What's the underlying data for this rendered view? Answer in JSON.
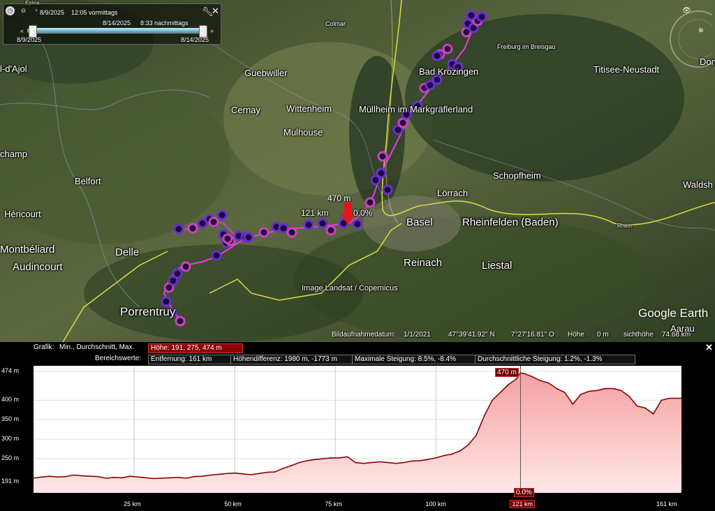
{
  "time_slider": {
    "start_datetime": "8/9/2025",
    "start_time": "12:05 vormittags",
    "current_datetime": "8/14/2025",
    "current_time": "8:33 nachmittags",
    "range_start": "8/9/2025",
    "range_end": "8/14/2025"
  },
  "map": {
    "places": [
      {
        "name": "Colmar",
        "size": "small"
      },
      {
        "name": "Freiburg im Breisgau",
        "size": "small"
      },
      {
        "name": "Bad Krozingen",
        "size": "normal"
      },
      {
        "name": "Titisee-Neustadt",
        "size": "normal"
      },
      {
        "name": "Guebwiller",
        "size": "normal"
      },
      {
        "name": "Cernay",
        "size": "normal"
      },
      {
        "name": "Wittenheim",
        "size": "normal"
      },
      {
        "name": "Müllheim im Markgräflerland",
        "size": "normal"
      },
      {
        "name": "Mulhouse",
        "size": "normal"
      },
      {
        "name": "Schopfheim",
        "size": "normal"
      },
      {
        "name": "Belfort",
        "size": "normal"
      },
      {
        "name": "Héricourt",
        "size": "normal"
      },
      {
        "name": "Lörrach",
        "size": "normal"
      },
      {
        "name": "Basel",
        "size": "big"
      },
      {
        "name": "Rheinfelden (Baden)",
        "size": "big"
      },
      {
        "name": "Montbéliard",
        "size": "big"
      },
      {
        "name": "Delle",
        "size": "big"
      },
      {
        "name": "Audincourt",
        "size": "big"
      },
      {
        "name": "Reinach",
        "size": "big"
      },
      {
        "name": "Liestal",
        "size": "big"
      },
      {
        "name": "Porrentruy",
        "size": "big"
      },
      {
        "name": "Waldsh",
        "size": "normal"
      },
      {
        "name": "Epina",
        "size": "tiny"
      },
      {
        "name": "l-d'Ajol",
        "size": "normal"
      },
      {
        "name": "champ",
        "size": "normal"
      },
      {
        "name": "Don",
        "size": "normal"
      },
      {
        "name": "Aarau",
        "size": "normal"
      },
      {
        "name": "Rhein",
        "size": "tiny"
      }
    ],
    "image_credit": "Image Landsat / Copernicus",
    "logo": "Google Earth",
    "marker": {
      "elevation": "470 m",
      "distance": "121 km",
      "slope": "0.0%"
    },
    "status": {
      "imagery_date_label": "Bildaufnahmedatum:",
      "imagery_date": "1/1/2021",
      "lat": "47°39'41.92\" N",
      "lon": "7°27'16.81\" O",
      "elev_label": "Höhe",
      "elev": "0 m",
      "eye_label": "sichthöhe",
      "eye": "74.68 km"
    },
    "colors": {
      "track_line": "#e040e0",
      "point_purple": "#6a2fd0",
      "point_magenta": "#d040c0",
      "border_yellow": "#d8e040"
    }
  },
  "profile": {
    "graph_label": "Grafik:",
    "graph_modes": "Min., Durchschnitt, Max.",
    "height_stats": "Höhe: 191, 275, 474 m",
    "range_label": "Bereichswerte:",
    "distance_stat": "Entfernung: 161 km",
    "height_diff": "Höhendifferenz: 1980 m, -1773 m",
    "max_slope": "Maximale Steigung: 8.5%, -8.4%",
    "avg_slope": "Durchschnittliche Steigung: 1.2%, -1.3%",
    "cursor_elev_label": "470 m",
    "cursor_slope_label": "0.0%",
    "cursor_dist_label": "121 km",
    "colors": {
      "line": "#8b0000",
      "fill_top": "#f4a0a0",
      "fill_bottom": "#ffe8e8"
    }
  },
  "chart_data": {
    "type": "area",
    "title": "",
    "xlabel": "",
    "ylabel": "",
    "x_unit": "km",
    "y_unit": "m",
    "ylim": [
      191,
      474
    ],
    "xlim": [
      0,
      161
    ],
    "y_ticks": [
      "191 m",
      "250 m",
      "300 m",
      "350 m",
      "400 m",
      "474 m"
    ],
    "y_tick_values": [
      191,
      250,
      300,
      350,
      400,
      474
    ],
    "x_ticks": [
      "25 km",
      "50 km",
      "75 km",
      "100 km",
      "121 km",
      "161 km"
    ],
    "x_tick_values": [
      25,
      50,
      75,
      100,
      121,
      161
    ],
    "x": [
      0,
      2,
      4,
      6,
      8,
      10,
      12,
      14,
      16,
      18,
      20,
      22,
      24,
      26,
      28,
      30,
      32,
      34,
      36,
      38,
      40,
      42,
      44,
      46,
      48,
      50,
      52,
      54,
      56,
      58,
      60,
      62,
      64,
      66,
      68,
      70,
      72,
      74,
      76,
      78,
      80,
      82,
      84,
      86,
      88,
      90,
      92,
      94,
      96,
      98,
      100,
      102,
      104,
      106,
      108,
      110,
      112,
      114,
      116,
      118,
      120,
      121,
      122,
      124,
      126,
      128,
      130,
      132,
      134,
      136,
      138,
      140,
      142,
      144,
      146,
      148,
      150,
      152,
      154,
      156,
      158,
      161
    ],
    "y": [
      200,
      203,
      205,
      203,
      204,
      208,
      206,
      205,
      204,
      200,
      202,
      201,
      205,
      203,
      201,
      199,
      200,
      201,
      202,
      200,
      204,
      205,
      208,
      210,
      212,
      213,
      211,
      209,
      212,
      215,
      216,
      225,
      232,
      240,
      245,
      248,
      250,
      252,
      252,
      255,
      240,
      238,
      240,
      242,
      240,
      238,
      240,
      244,
      245,
      248,
      252,
      258,
      262,
      270,
      285,
      310,
      360,
      400,
      420,
      440,
      455,
      470,
      468,
      460,
      450,
      444,
      430,
      420,
      390,
      415,
      423,
      425,
      430,
      430,
      425,
      410,
      385,
      380,
      365,
      400,
      405,
      405
    ]
  }
}
